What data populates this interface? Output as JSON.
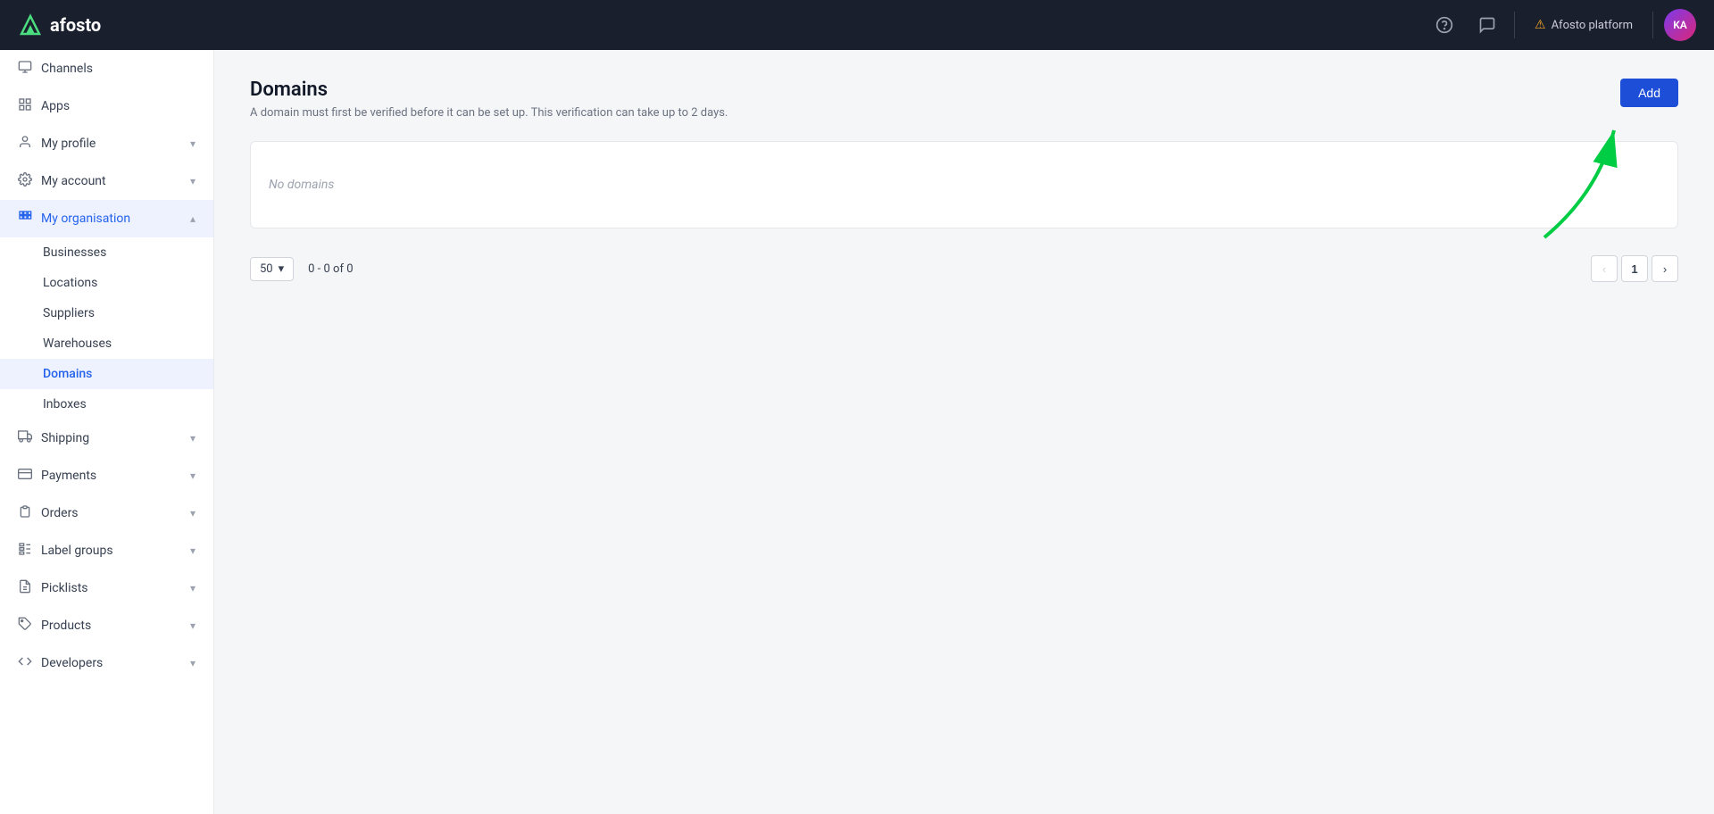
{
  "topnav": {
    "logo_text": "afosto",
    "help_icon": "?",
    "chat_icon": "💬",
    "platform_label": "Afosto platform",
    "avatar_initials": "KA"
  },
  "sidebar": {
    "items": [
      {
        "id": "channels",
        "label": "Channels",
        "icon": "channels",
        "expandable": false,
        "active": false
      },
      {
        "id": "apps",
        "label": "Apps",
        "icon": "apps",
        "expandable": false,
        "active": false
      },
      {
        "id": "my-profile",
        "label": "My profile",
        "icon": "person",
        "expandable": true,
        "active": false
      },
      {
        "id": "my-account",
        "label": "My account",
        "icon": "gear",
        "expandable": true,
        "active": false
      },
      {
        "id": "my-organisation",
        "label": "My organisation",
        "icon": "org",
        "expandable": true,
        "active": true,
        "children": [
          {
            "id": "businesses",
            "label": "Businesses",
            "active": false
          },
          {
            "id": "locations",
            "label": "Locations",
            "active": false
          },
          {
            "id": "suppliers",
            "label": "Suppliers",
            "active": false
          },
          {
            "id": "warehouses",
            "label": "Warehouses",
            "active": false
          },
          {
            "id": "domains",
            "label": "Domains",
            "active": true
          },
          {
            "id": "inboxes",
            "label": "Inboxes",
            "active": false
          }
        ]
      },
      {
        "id": "shipping",
        "label": "Shipping",
        "icon": "shipping",
        "expandable": true,
        "active": false
      },
      {
        "id": "payments",
        "label": "Payments",
        "icon": "payments",
        "expandable": true,
        "active": false
      },
      {
        "id": "orders",
        "label": "Orders",
        "icon": "orders",
        "expandable": true,
        "active": false
      },
      {
        "id": "label-groups",
        "label": "Label groups",
        "icon": "labelgroups",
        "expandable": true,
        "active": false
      },
      {
        "id": "picklists",
        "label": "Picklists",
        "icon": "picklists",
        "expandable": true,
        "active": false
      },
      {
        "id": "products",
        "label": "Products",
        "icon": "products",
        "expandable": true,
        "active": false
      },
      {
        "id": "developers",
        "label": "Developers",
        "icon": "developers",
        "expandable": true,
        "active": false
      }
    ]
  },
  "main": {
    "page_title": "Domains",
    "page_subtitle": "A domain must first be verified before it can be set up. This verification can take up to 2 days.",
    "empty_state_text": "No domains",
    "add_button_label": "Add",
    "pagination": {
      "per_page": "50",
      "range_text": "0 - 0 of 0",
      "current_page": "1"
    }
  }
}
